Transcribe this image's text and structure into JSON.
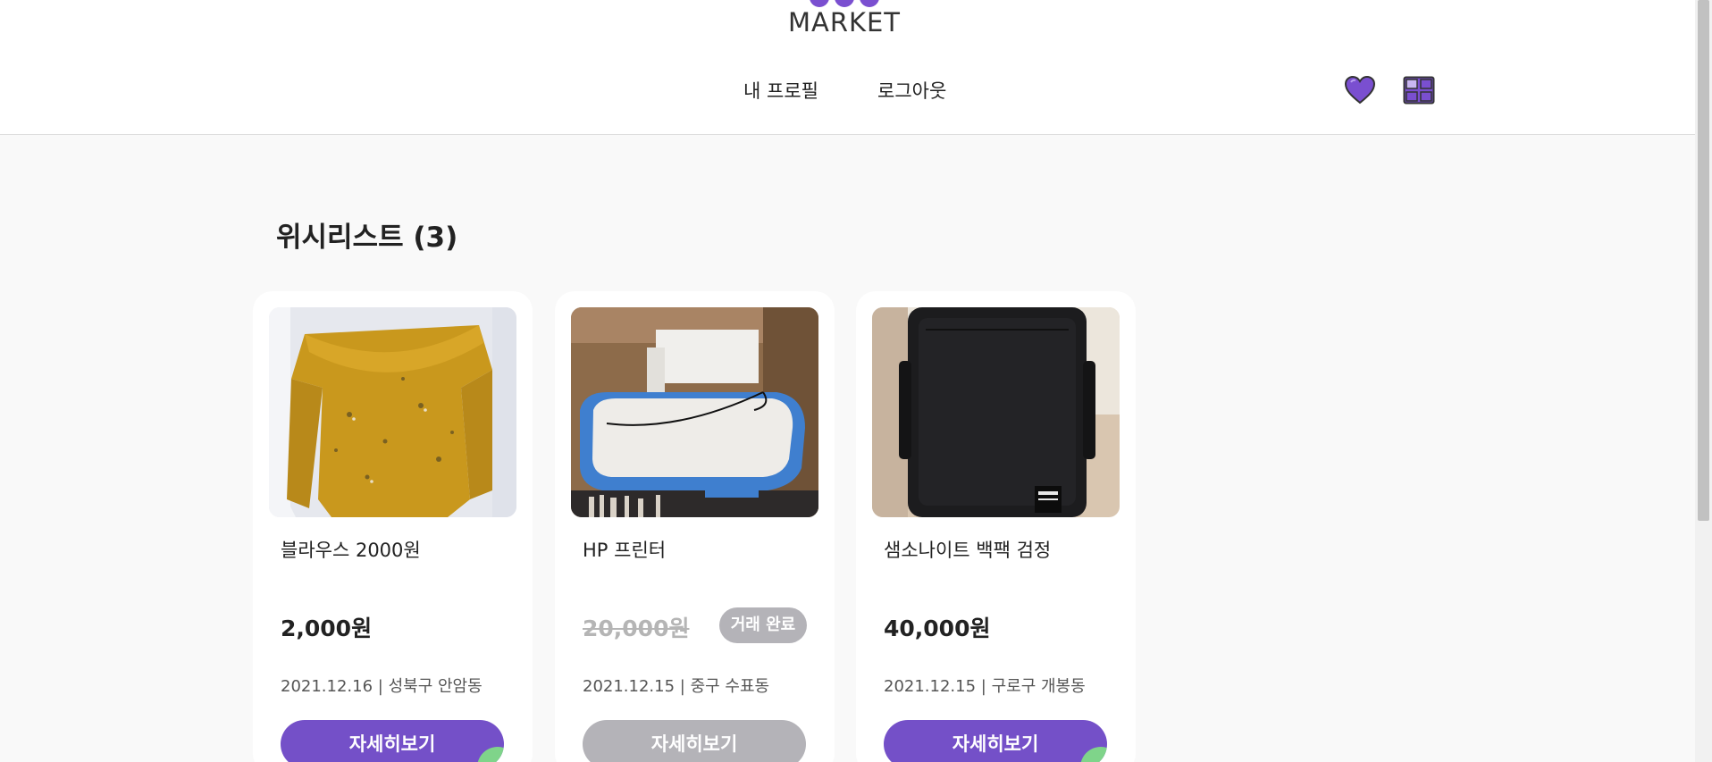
{
  "header": {
    "logo_text": "MARKET",
    "nav": {
      "profile": "내 프로필",
      "logout": "로그아웃"
    },
    "icons": [
      "heart-icon",
      "grid-icon"
    ],
    "accent": "#7450c8"
  },
  "wishlist": {
    "title": "위시리스트 (3)",
    "items": [
      {
        "title": "블라우스 2000원",
        "price": "2,000원",
        "meta": "2021.12.16 | 성북구 안암동",
        "button": "자세히보기",
        "sold": false
      },
      {
        "title": "HP 프린터",
        "price": "20,000원",
        "badge": "거래 완료",
        "meta": "2021.12.15 | 중구 수표동",
        "button": "자세히보기",
        "sold": true
      },
      {
        "title": "샘소나이트 백팩 검정",
        "price": "40,000원",
        "meta": "2021.12.15 | 구로구 개봉동",
        "button": "자세히보기",
        "sold": false
      }
    ]
  }
}
